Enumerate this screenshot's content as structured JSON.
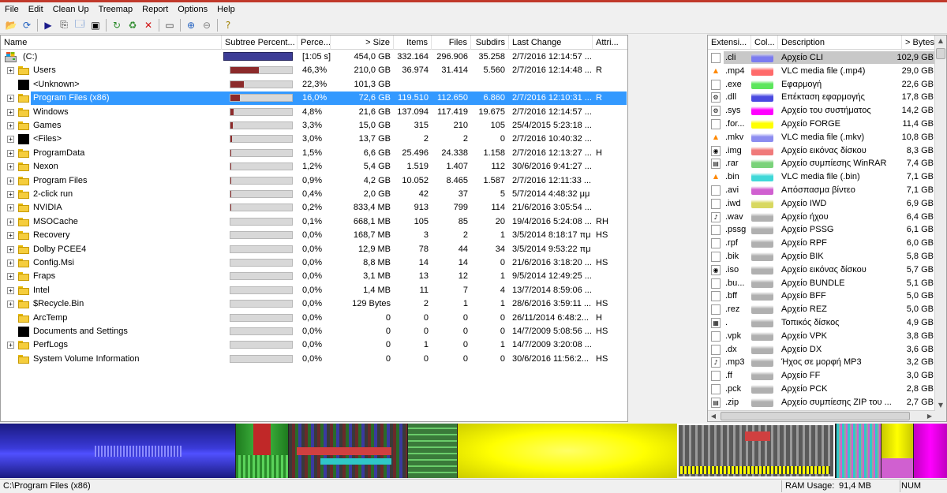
{
  "menu": [
    "File",
    "Edit",
    "Clean Up",
    "Treemap",
    "Report",
    "Options",
    "Help"
  ],
  "toolbar": [
    {
      "icon": "open-folder-icon",
      "glyph": "📂"
    },
    {
      "icon": "refresh-all-icon",
      "glyph": "⟳"
    },
    {
      "icon": "play-icon",
      "glyph": "▶"
    },
    {
      "icon": "copy-path-icon",
      "glyph": "⎘"
    },
    {
      "icon": "explorer-icon",
      "glyph": "🗔"
    },
    {
      "icon": "command-prompt-icon",
      "glyph": "▣"
    },
    {
      "icon": "refresh-icon",
      "glyph": "↻"
    },
    {
      "icon": "recycle-bin-icon",
      "glyph": "♻"
    },
    {
      "icon": "delete-icon",
      "glyph": "✕"
    },
    {
      "icon": "properties-icon",
      "glyph": "▭"
    },
    {
      "icon": "zoom-in-icon",
      "glyph": "⊕"
    },
    {
      "icon": "zoom-out-icon",
      "glyph": "⊖"
    },
    {
      "icon": "help-icon",
      "glyph": "?"
    }
  ],
  "dir_columns": [
    "Name",
    "Subtree Percent...",
    "Perce...",
    "> Size",
    "Items",
    "Files",
    "Subdirs",
    "Last Change",
    "Attri..."
  ],
  "dir_rows": [
    {
      "name": "(C:)",
      "kind": "drive",
      "expander": "",
      "subtree": 1.0,
      "percent": "[1:05 s]",
      "size": "454,0 GB",
      "items": "332.164",
      "files": "296.906",
      "subdirs": "35.258",
      "last_change": "2/7/2016 12:14:57 ...",
      "attr": ""
    },
    {
      "name": "Users",
      "kind": "folder",
      "expander": "+",
      "subtree": 0.463,
      "percent": "46,3%",
      "size": "210,0 GB",
      "items": "36.974",
      "files": "31.414",
      "subdirs": "5.560",
      "last_change": "2/7/2016 12:14:48 ...",
      "attr": "R"
    },
    {
      "name": "<Unknown>",
      "kind": "black",
      "expander": "",
      "subtree": 0.223,
      "percent": "22,3%",
      "size": "101,3 GB",
      "items": "",
      "files": "",
      "subdirs": "",
      "last_change": "",
      "attr": ""
    },
    {
      "name": "Program Files (x86)",
      "kind": "folder",
      "expander": "+",
      "subtree": 0.16,
      "percent": "16,0%",
      "size": "72,6 GB",
      "items": "119.510",
      "files": "112.650",
      "subdirs": "6.860",
      "last_change": "2/7/2016 12:10:31 ...",
      "attr": "R",
      "selected": true
    },
    {
      "name": "Windows",
      "kind": "folder",
      "expander": "+",
      "subtree": 0.048,
      "percent": "4,8%",
      "size": "21,6 GB",
      "items": "137.094",
      "files": "117.419",
      "subdirs": "19.675",
      "last_change": "2/7/2016 12:14:57 ...",
      "attr": ""
    },
    {
      "name": "Games",
      "kind": "folder",
      "expander": "+",
      "subtree": 0.033,
      "percent": "3,3%",
      "size": "15,0 GB",
      "items": "315",
      "files": "210",
      "subdirs": "105",
      "last_change": "25/4/2015 5:23:18 ...",
      "attr": ""
    },
    {
      "name": "<Files>",
      "kind": "black",
      "expander": "+",
      "subtree": 0.03,
      "percent": "3,0%",
      "size": "13,7 GB",
      "items": "2",
      "files": "2",
      "subdirs": "0",
      "last_change": "2/7/2016 10:40:32 ...",
      "attr": ""
    },
    {
      "name": "ProgramData",
      "kind": "folder",
      "expander": "+",
      "subtree": 0.015,
      "percent": "1,5%",
      "size": "6,6 GB",
      "items": "25.496",
      "files": "24.338",
      "subdirs": "1.158",
      "last_change": "2/7/2016 12:13:27 ...",
      "attr": "H"
    },
    {
      "name": "Nexon",
      "kind": "folder",
      "expander": "+",
      "subtree": 0.012,
      "percent": "1,2%",
      "size": "5,4 GB",
      "items": "1.519",
      "files": "1.407",
      "subdirs": "112",
      "last_change": "30/6/2016 9:41:27 ...",
      "attr": ""
    },
    {
      "name": "Program Files",
      "kind": "folder",
      "expander": "+",
      "subtree": 0.009,
      "percent": "0,9%",
      "size": "4,2 GB",
      "items": "10.052",
      "files": "8.465",
      "subdirs": "1.587",
      "last_change": "2/7/2016 12:11:33 ...",
      "attr": ""
    },
    {
      "name": "2-click run",
      "kind": "folder",
      "expander": "+",
      "subtree": 0.004,
      "percent": "0,4%",
      "size": "2,0 GB",
      "items": "42",
      "files": "37",
      "subdirs": "5",
      "last_change": "5/7/2014 4:48:32 μμ",
      "attr": ""
    },
    {
      "name": "NVIDIA",
      "kind": "folder",
      "expander": "+",
      "subtree": 0.002,
      "percent": "0,2%",
      "size": "833,4 MB",
      "items": "913",
      "files": "799",
      "subdirs": "114",
      "last_change": "21/6/2016 3:05:54 ...",
      "attr": ""
    },
    {
      "name": "MSOCache",
      "kind": "folder",
      "expander": "+",
      "subtree": 0.001,
      "percent": "0,1%",
      "size": "668,1 MB",
      "items": "105",
      "files": "85",
      "subdirs": "20",
      "last_change": "19/4/2016 5:24:08 ...",
      "attr": "RH"
    },
    {
      "name": "Recovery",
      "kind": "folder",
      "expander": "+",
      "subtree": 0.0,
      "percent": "0,0%",
      "size": "168,7 MB",
      "items": "3",
      "files": "2",
      "subdirs": "1",
      "last_change": "3/5/2014 8:18:17 πμ",
      "attr": "HS"
    },
    {
      "name": "Dolby PCEE4",
      "kind": "folder",
      "expander": "+",
      "subtree": 0.0,
      "percent": "0,0%",
      "size": "12,9 MB",
      "items": "78",
      "files": "44",
      "subdirs": "34",
      "last_change": "3/5/2014 9:53:22 πμ",
      "attr": ""
    },
    {
      "name": "Config.Msi",
      "kind": "folder",
      "expander": "+",
      "subtree": 0.0,
      "percent": "0,0%",
      "size": "8,8 MB",
      "items": "14",
      "files": "14",
      "subdirs": "0",
      "last_change": "21/6/2016 3:18:20 ...",
      "attr": "HS"
    },
    {
      "name": "Fraps",
      "kind": "folder",
      "expander": "+",
      "subtree": 0.0,
      "percent": "0,0%",
      "size": "3,1 MB",
      "items": "13",
      "files": "12",
      "subdirs": "1",
      "last_change": "9/5/2014 12:49:25 ...",
      "attr": ""
    },
    {
      "name": "Intel",
      "kind": "folder",
      "expander": "+",
      "subtree": 0.0,
      "percent": "0,0%",
      "size": "1,4 MB",
      "items": "11",
      "files": "7",
      "subdirs": "4",
      "last_change": "13/7/2014 8:59:06 ...",
      "attr": ""
    },
    {
      "name": "$Recycle.Bin",
      "kind": "folder",
      "expander": "+",
      "subtree": 0.0,
      "percent": "0,0%",
      "size": "129 Bytes",
      "items": "2",
      "files": "1",
      "subdirs": "1",
      "last_change": "28/6/2016 3:59:11 ...",
      "attr": "HS"
    },
    {
      "name": "ArcTemp",
      "kind": "folder",
      "expander": "",
      "subtree": 0.0,
      "percent": "0,0%",
      "size": "0",
      "items": "0",
      "files": "0",
      "subdirs": "0",
      "last_change": "26/11/2014 6:48:2...",
      "attr": "H"
    },
    {
      "name": "Documents and Settings",
      "kind": "black",
      "expander": "",
      "subtree": 0.0,
      "percent": "0,0%",
      "size": "0",
      "items": "0",
      "files": "0",
      "subdirs": "0",
      "last_change": "14/7/2009 5:08:56 ...",
      "attr": "HS"
    },
    {
      "name": "PerfLogs",
      "kind": "folder",
      "expander": "+",
      "subtree": 0.0,
      "percent": "0,0%",
      "size": "0",
      "items": "1",
      "files": "0",
      "subdirs": "1",
      "last_change": "14/7/2009 3:20:08 ...",
      "attr": ""
    },
    {
      "name": "System Volume Information",
      "kind": "folder",
      "expander": "",
      "subtree": 0.0,
      "percent": "0,0%",
      "size": "0",
      "items": "0",
      "files": "0",
      "subdirs": "0",
      "last_change": "30/6/2016 11:56:2...",
      "attr": "HS"
    }
  ],
  "ext_columns": [
    "Extensi...",
    "Col...",
    "Description",
    "> Bytes"
  ],
  "ext_rows": [
    {
      "ext": ".cli",
      "color": "#7b7bf0",
      "desc": "Αρχείο CLI",
      "bytes": "102,9 GB",
      "icon": "",
      "selected": true
    },
    {
      "ext": ".mp4",
      "color": "#ff6a6a",
      "desc": "VLC media file (.mp4)",
      "bytes": "29,0 GB",
      "icon": "▲"
    },
    {
      "ext": ".exe",
      "color": "#5ce65c",
      "desc": "Εφαρμογή",
      "bytes": "22,6 GB",
      "icon": ""
    },
    {
      "ext": ".dll",
      "color": "#4a4ae0",
      "desc": "Επέκταση εφαρμογής",
      "bytes": "17,8 GB",
      "icon": "⚙"
    },
    {
      "ext": ".sys",
      "color": "#ff00ff",
      "desc": "Αρχείο του συστήματος",
      "bytes": "14,2 GB",
      "icon": "⚙"
    },
    {
      "ext": ".for...",
      "color": "#ffff00",
      "desc": "Αρχείο FORGE",
      "bytes": "11,4 GB",
      "icon": ""
    },
    {
      "ext": ".mkv",
      "color": "#8c8cf0",
      "desc": "VLC media file (.mkv)",
      "bytes": "10,8 GB",
      "icon": "▲"
    },
    {
      "ext": ".img",
      "color": "#f07a7a",
      "desc": "Αρχείο εικόνας δίσκου",
      "bytes": "8,3 GB",
      "icon": "◉"
    },
    {
      "ext": ".rar",
      "color": "#7ad27a",
      "desc": "Αρχείο συμπίεσης WinRAR",
      "bytes": "7,4 GB",
      "icon": "▤"
    },
    {
      "ext": ".bin",
      "color": "#40d8d8",
      "desc": "VLC media file (.bin)",
      "bytes": "7,1 GB",
      "icon": "▲"
    },
    {
      "ext": ".avi",
      "color": "#d060d0",
      "desc": "Απόσπασμα βίντεο",
      "bytes": "7,1 GB",
      "icon": ""
    },
    {
      "ext": ".iwd",
      "color": "#d8d860",
      "desc": "Αρχείο IWD",
      "bytes": "6,9 GB",
      "icon": ""
    },
    {
      "ext": ".wav",
      "color": "#b0b0b0",
      "desc": "Αρχείο ήχου",
      "bytes": "6,4 GB",
      "icon": "♪"
    },
    {
      "ext": ".pssg",
      "color": "#b0b0b0",
      "desc": "Αρχείο PSSG",
      "bytes": "6,1 GB",
      "icon": ""
    },
    {
      "ext": ".rpf",
      "color": "#b0b0b0",
      "desc": "Αρχείο RPF",
      "bytes": "6,0 GB",
      "icon": ""
    },
    {
      "ext": ".bik",
      "color": "#b0b0b0",
      "desc": "Αρχείο BIK",
      "bytes": "5,8 GB",
      "icon": ""
    },
    {
      "ext": ".iso",
      "color": "#b0b0b0",
      "desc": "Αρχείο εικόνας δίσκου",
      "bytes": "5,7 GB",
      "icon": "◉"
    },
    {
      "ext": ".bu...",
      "color": "#b0b0b0",
      "desc": "Αρχείο BUNDLE",
      "bytes": "5,1 GB",
      "icon": ""
    },
    {
      "ext": ".bff",
      "color": "#b0b0b0",
      "desc": "Αρχείο BFF",
      "bytes": "5,0 GB",
      "icon": ""
    },
    {
      "ext": ".rez",
      "color": "#b0b0b0",
      "desc": "Αρχείο REZ",
      "bytes": "5,0 GB",
      "icon": ""
    },
    {
      "ext": ".",
      "color": "#b0b0b0",
      "desc": "Τοπικός δίσκος",
      "bytes": "4,9 GB",
      "icon": "▦"
    },
    {
      "ext": ".vpk",
      "color": "#b0b0b0",
      "desc": "Αρχείο VPK",
      "bytes": "3,8 GB",
      "icon": ""
    },
    {
      "ext": ".dx",
      "color": "#b0b0b0",
      "desc": "Αρχείο DX",
      "bytes": "3,6 GB",
      "icon": ""
    },
    {
      "ext": ".mp3",
      "color": "#b0b0b0",
      "desc": "Ήχος σε μορφή MP3",
      "bytes": "3,2 GB",
      "icon": "♪"
    },
    {
      "ext": ".ff",
      "color": "#b0b0b0",
      "desc": "Αρχείο FF",
      "bytes": "3,0 GB",
      "icon": ""
    },
    {
      "ext": ".pck",
      "color": "#b0b0b0",
      "desc": "Αρχείο PCK",
      "bytes": "2,8 GB",
      "icon": ""
    },
    {
      "ext": ".zip",
      "color": "#b0b0b0",
      "desc": "Αρχείο συμπίεσης ZIP του ...",
      "bytes": "2,7 GB",
      "icon": "▤"
    }
  ],
  "treemap_colors": {
    "dll_blue": "#2a2ab8",
    "exe_green": "#3aa03a",
    "mp4_red": "#cc3030",
    "forge_yellow": "#ffff00",
    "cli_gray": "#7a7a7a",
    "bin_cyan": "#30c8c8",
    "sys_magenta": "#ff00ff",
    "iwd_olive": "#c8c840"
  },
  "status": {
    "path": "C:\\Program Files (x86)",
    "ram_label": "RAM Usage:",
    "ram_value": "91,4 MB",
    "num": "NUM"
  }
}
